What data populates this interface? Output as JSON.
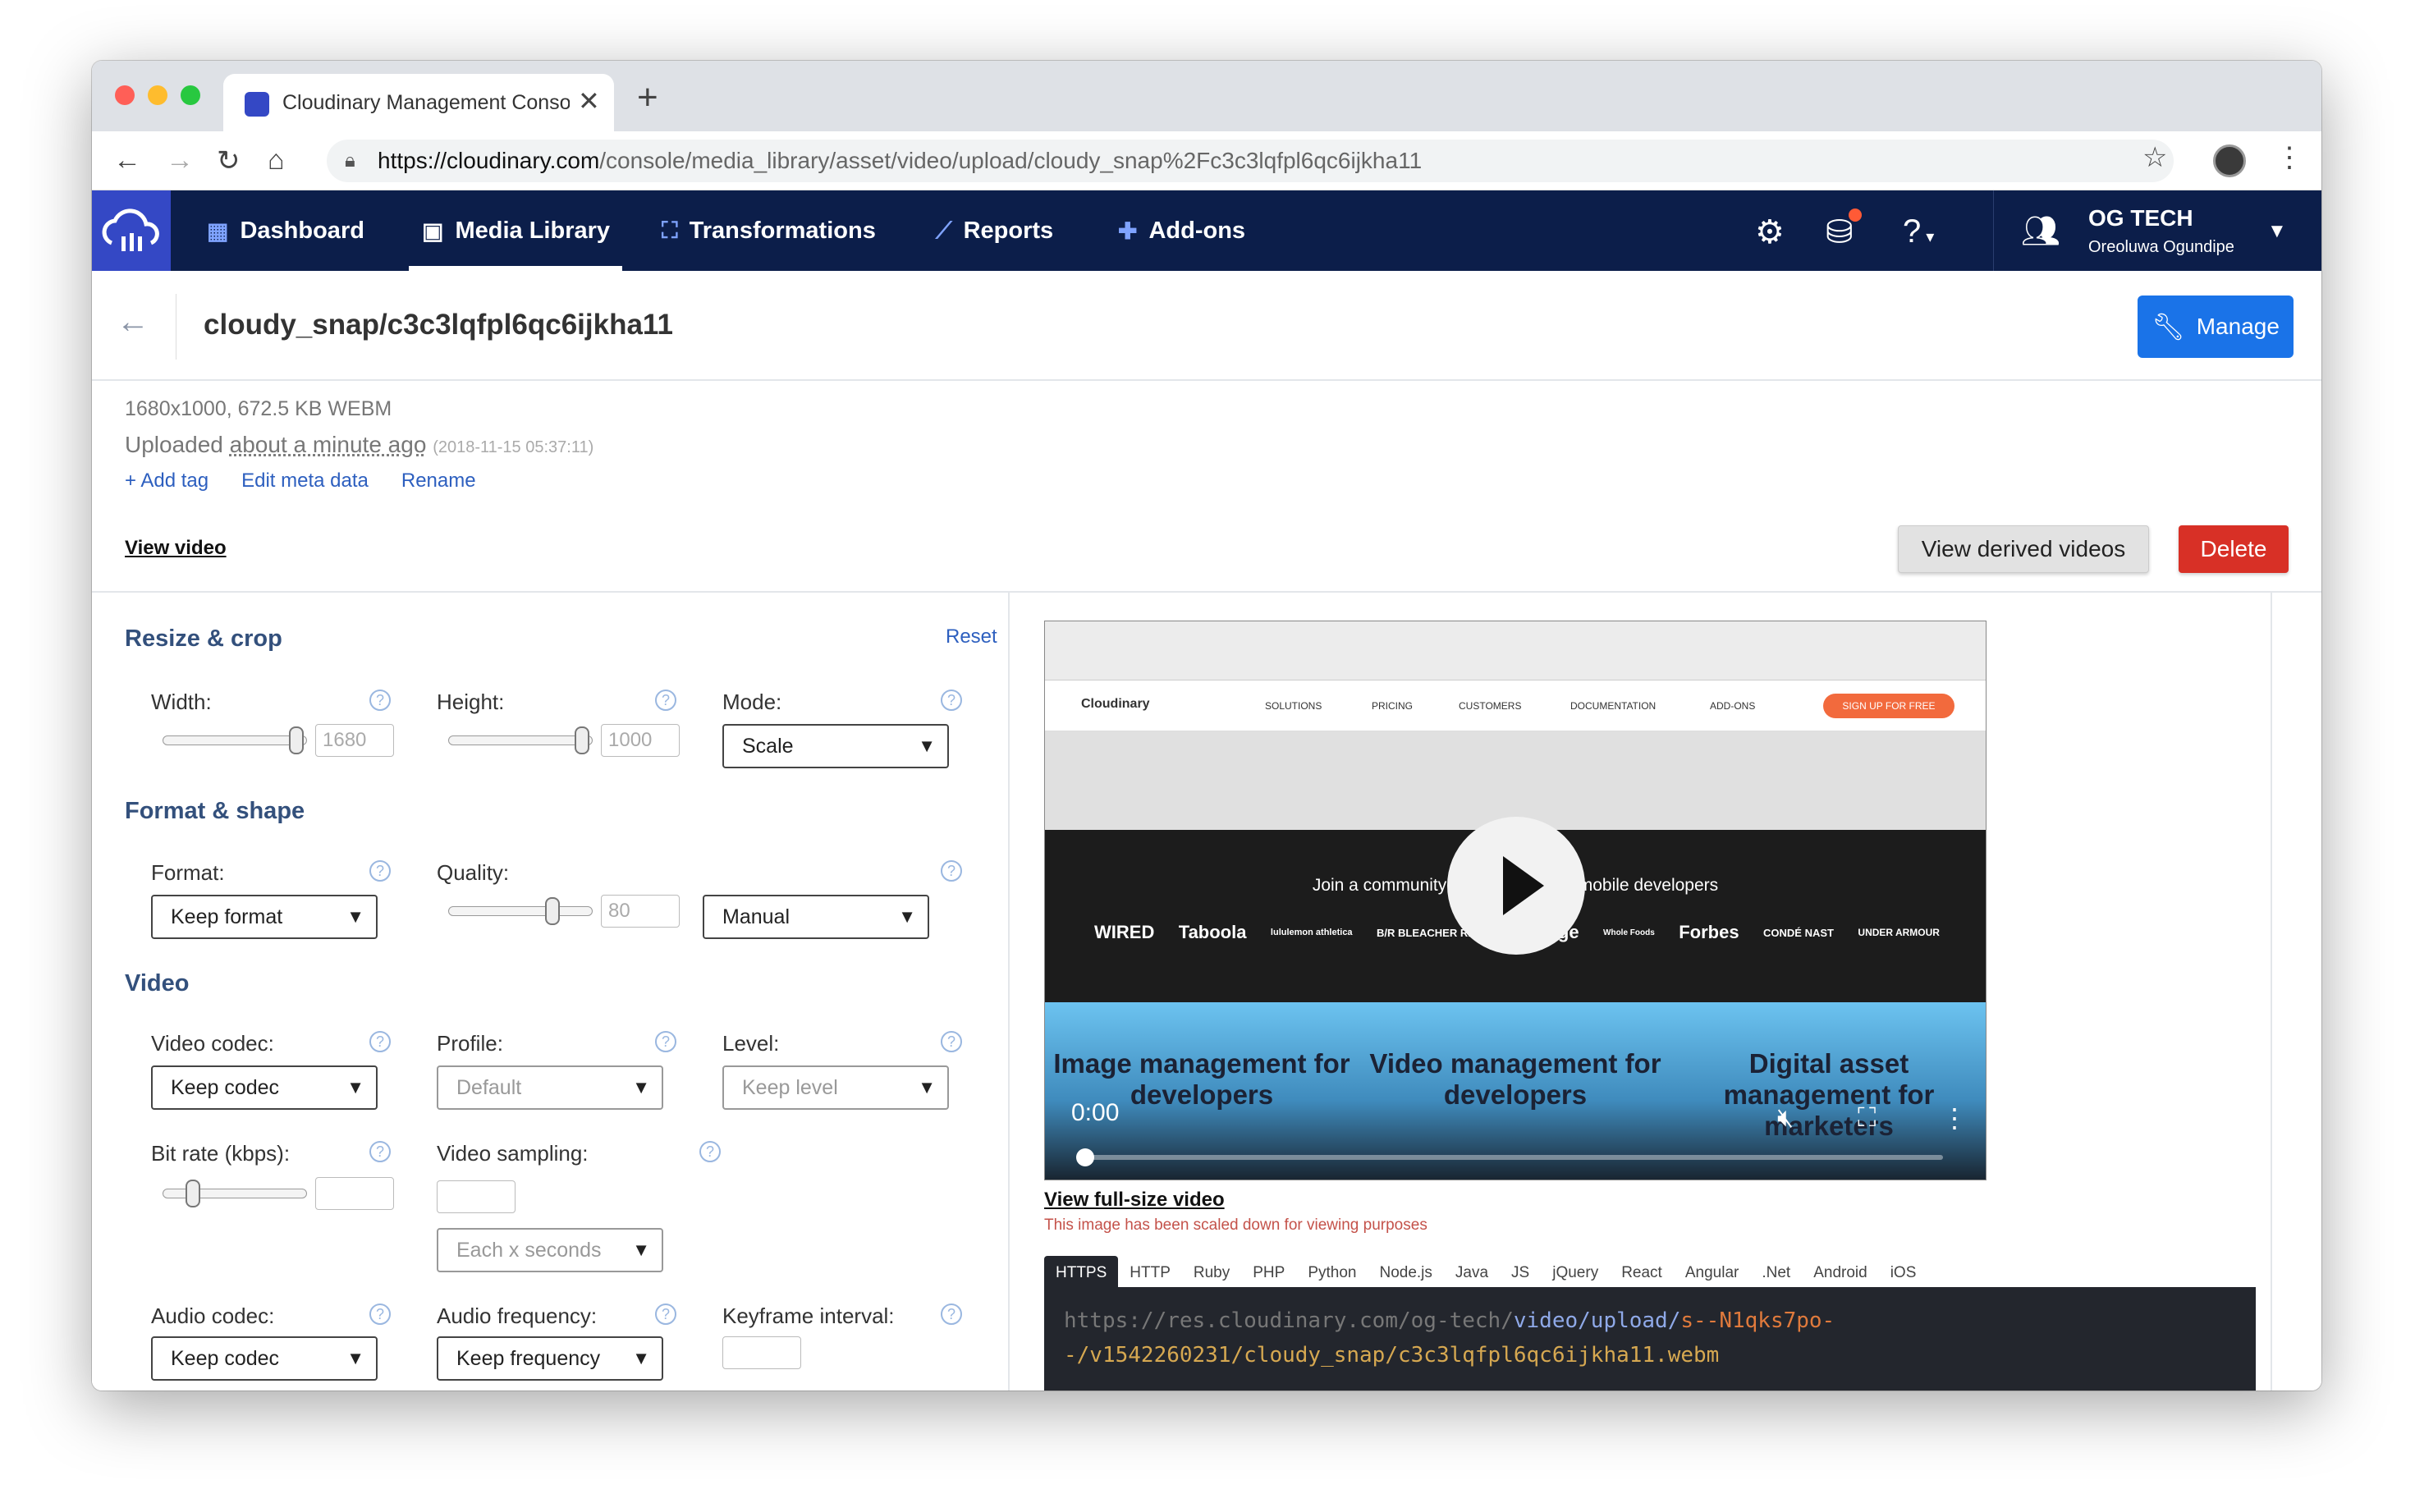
{
  "browser": {
    "tab_title": "Cloudinary Management Conso",
    "url_host": "https://cloudinary.com",
    "url_path": "/console/media_library/asset/video/upload/cloudy_snap%2Fc3c3lqfpl6qc6ijkha11"
  },
  "nav": {
    "items": [
      {
        "label": "Dashboard",
        "icon": "dashboard-icon"
      },
      {
        "label": "Media Library",
        "icon": "media-library-icon"
      },
      {
        "label": "Transformations",
        "icon": "transformations-icon"
      },
      {
        "label": "Reports",
        "icon": "reports-icon"
      },
      {
        "label": "Add-ons",
        "icon": "addons-icon"
      }
    ],
    "active": "Media Library",
    "account_name": "OG TECH",
    "account_user": "Oreoluwa Ogundipe"
  },
  "asset": {
    "title": "cloudy_snap/c3c3lqfpl6qc6ijkha11",
    "manage_label": "Manage",
    "info": "1680x1000, 672.5 KB WEBM",
    "uploaded_prefix": "Uploaded ",
    "uploaded_ago": "about a minute ago",
    "uploaded_ts": "(2018-11-15 05:37:11)",
    "add_tag": "+ Add tag",
    "edit_meta": "Edit meta data",
    "rename": "Rename",
    "view_video": "View video",
    "view_derived": "View derived videos",
    "delete": "Delete"
  },
  "panel": {
    "resize_title": "Resize & crop",
    "reset": "Reset",
    "width_label": "Width:",
    "width_value": "1680",
    "height_label": "Height:",
    "height_value": "1000",
    "mode_label": "Mode:",
    "mode_value": "Scale",
    "format_title": "Format & shape",
    "format_label": "Format:",
    "format_value": "Keep format",
    "quality_label": "Quality:",
    "quality_value": "80",
    "quality_mode": "Manual",
    "video_title": "Video",
    "vcodec_label": "Video codec:",
    "vcodec_value": "Keep codec",
    "profile_label": "Profile:",
    "profile_value": "Default",
    "level_label": "Level:",
    "level_value": "Keep level",
    "bitrate_label": "Bit rate (kbps):",
    "sampling_label": "Video sampling:",
    "sampling_value": "Each x seconds",
    "acodec_label": "Audio codec:",
    "acodec_value": "Keep codec",
    "afreq_label": "Audio frequency:",
    "afreq_value": "Keep frequency",
    "keyframe_label": "Keyframe interval:"
  },
  "player": {
    "time": "0:00",
    "community_text": "Join a community of 375K+ web & mobile developers",
    "col1": "Image management for developers",
    "col2": "Video management for developers",
    "col3": "Digital asset management for marketers",
    "site_nav": [
      "SOLUTIONS",
      "PRICING",
      "CUSTOMERS",
      "DOCUMENTATION",
      "ADD-ONS"
    ],
    "signup": "SIGN UP FOR FREE",
    "brand": "Cloudinary",
    "logos": [
      "WIRED",
      "Taboola",
      "lululemon athletica",
      "B/R BLEACHER REPORT",
      "Hinge",
      "Whole Foods",
      "Forbes",
      "CONDÉ NAST",
      "UNDER ARMOUR"
    ],
    "full_size_link": "View full-size video",
    "scaled_note": "This image has been scaled down for viewing purposes"
  },
  "code": {
    "tabs": [
      "HTTPS",
      "HTTP",
      "Ruby",
      "PHP",
      "Python",
      "Node.js",
      "Java",
      "JS",
      "jQuery",
      "React",
      "Angular",
      ".Net",
      "Android",
      "iOS"
    ],
    "active_tab": "HTTPS",
    "url_base": "https://res.cloudinary.com/og-tech/",
    "url_type": "video/upload/",
    "url_sig": "s--N1qks7po-",
    "url_rest": "-/v1542260231/cloudy_snap/c3c3lqfpl6qc6ijkha11.webm"
  }
}
